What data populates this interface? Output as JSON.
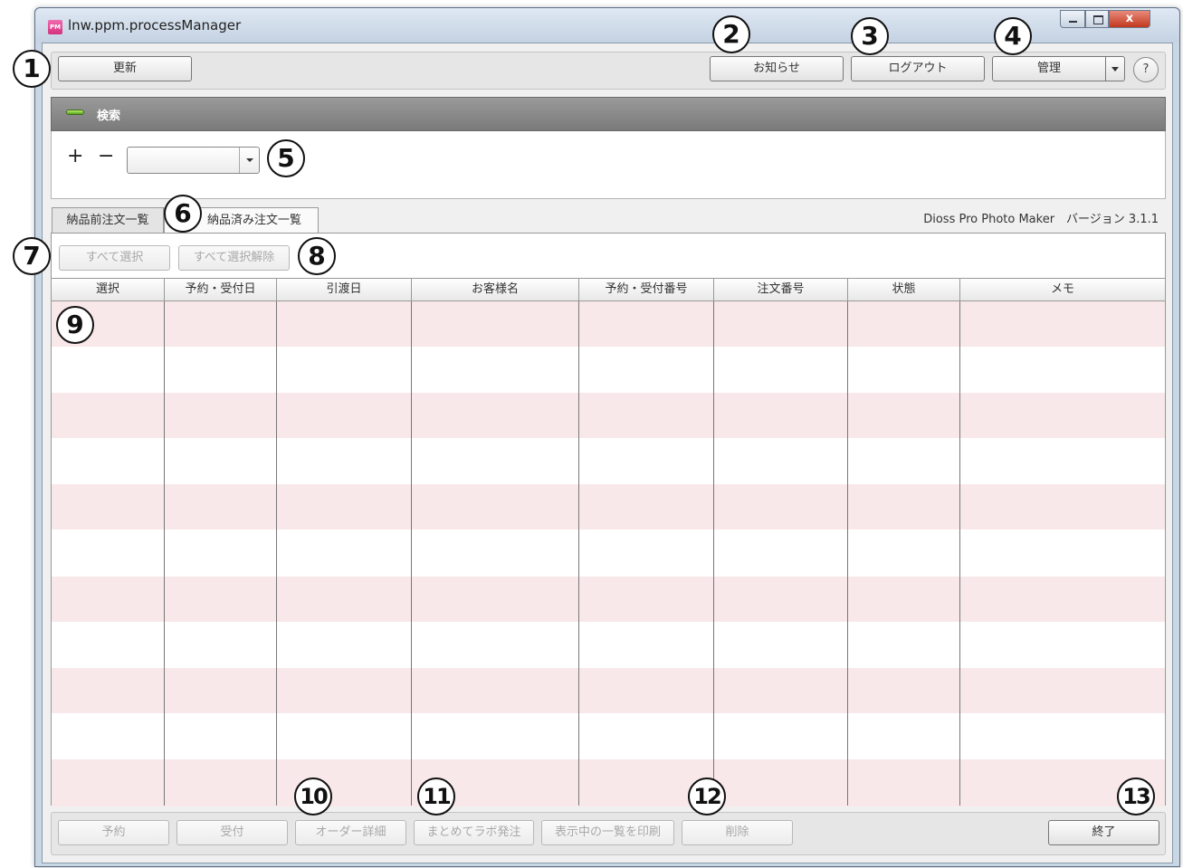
{
  "window": {
    "title": "lnw.ppm.processManager",
    "icon_text": "PM",
    "close_glyph": "x"
  },
  "toolbar": {
    "refresh": "更新",
    "notice": "お知らせ",
    "logout": "ログアウト",
    "admin": "管理",
    "help": "?"
  },
  "search": {
    "title": "検索",
    "plus": "+",
    "minus": "−",
    "condition_value": ""
  },
  "tabs": [
    {
      "label": "納品前注文一覧"
    },
    {
      "label": "納品済み注文一覧"
    }
  ],
  "version": "Dioss Pro Photo Maker　バージョン 3.1.1",
  "selection": {
    "select_all": "すべて選択",
    "deselect_all": "すべて選択解除"
  },
  "table": {
    "columns": [
      "選択",
      "予約・受付日",
      "引渡日",
      "お客様名",
      "予約・受付番号",
      "注文番号",
      "状態",
      "メモ"
    ]
  },
  "bottom": {
    "reserve": "予約",
    "accept": "受付",
    "order_detail": "オーダー詳細",
    "bulk_lab_order": "まとめてラボ発注",
    "print_list": "表示中の一覧を印刷",
    "delete": "削除",
    "exit": "終了"
  },
  "callouts": [
    "1",
    "2",
    "3",
    "4",
    "5",
    "6",
    "7",
    "8",
    "9",
    "10",
    "11",
    "12",
    "13"
  ]
}
